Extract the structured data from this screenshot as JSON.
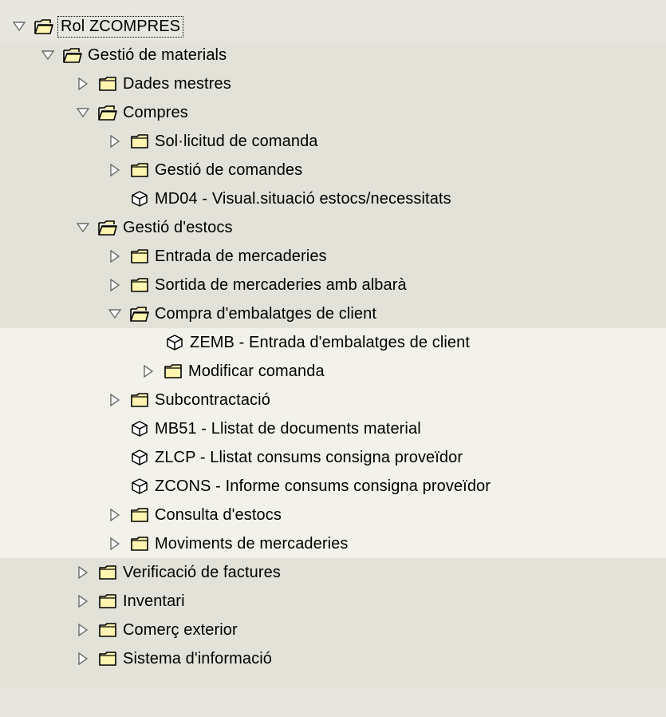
{
  "tree": {
    "root": {
      "label": "Rol ZCOMPRES"
    },
    "materials": {
      "label": "Gestió de materials"
    },
    "dades": {
      "label": "Dades mestres"
    },
    "compres": {
      "label": "Compres"
    },
    "sollicitud": {
      "label": "Sol·licitud de comanda"
    },
    "gestio_comandes": {
      "label": "Gestió de comandes"
    },
    "md04": {
      "label": "MD04 - Visual.situació estocs/necessitats"
    },
    "estocs": {
      "label": "Gestió d'estocs"
    },
    "entrada": {
      "label": "Entrada de mercaderies"
    },
    "sortida": {
      "label": "Sortida de mercaderies amb albarà"
    },
    "compra_emb": {
      "label": "Compra d'embalatges de client"
    },
    "zemb": {
      "label": "ZEMB - Entrada d'embalatges de client"
    },
    "modificar": {
      "label": "Modificar comanda"
    },
    "subcontractacio": {
      "label": "Subcontractació"
    },
    "mb51": {
      "label": "MB51 - Llistat de documents material"
    },
    "zlcp": {
      "label": "ZLCP - Llistat consums consigna proveïdor"
    },
    "zcons": {
      "label": "ZCONS - Informe consums consigna proveïdor"
    },
    "consulta": {
      "label": "Consulta d'estocs"
    },
    "moviments": {
      "label": "Moviments de mercaderies"
    },
    "verificacio": {
      "label": "Verificació de factures"
    },
    "inventari": {
      "label": "Inventari"
    },
    "comerc": {
      "label": "Comerç exterior"
    },
    "sistema": {
      "label": "Sistema d'informació"
    }
  },
  "icons": {
    "expanded": "triangle-down-icon",
    "collapsed": "triangle-right-icon",
    "folder_open": "folder-open-icon",
    "folder_closed": "folder-icon",
    "transaction": "transaction-cube-icon"
  },
  "colors": {
    "bg": "#e8e7df",
    "row_dark": "#e3e2d8",
    "row_light": "#f2f2ea"
  }
}
